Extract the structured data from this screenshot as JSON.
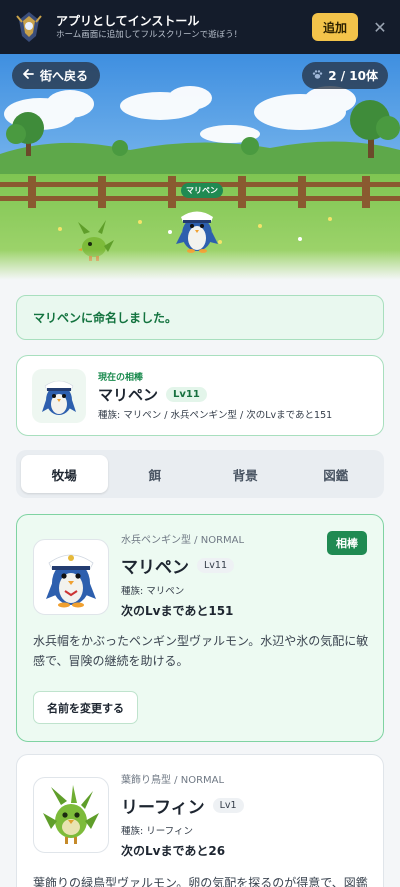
{
  "install_banner": {
    "title": "アプリとしてインストール",
    "subtitle": "ホーム画面に追加してフルスクリーンで遊ぼう！",
    "add_label": "追加",
    "close_glyph": "✕"
  },
  "hero": {
    "back_label": "街へ戻る",
    "count_label": "2 / 10体",
    "name_tag": "マリペン"
  },
  "notice": {
    "text": "マリペンに命名しました。"
  },
  "partner": {
    "label": "現在の相棒",
    "name": "マリペン",
    "level": "Lv11",
    "meta": "種族: マリペン / 水兵ペンギン型 / 次のLvまであと151"
  },
  "tabs": [
    {
      "label": "牧場",
      "active": true
    },
    {
      "label": "餌",
      "active": false
    },
    {
      "label": "背景",
      "active": false
    },
    {
      "label": "図鑑",
      "active": false
    }
  ],
  "monsters": [
    {
      "type_line": "水兵ペンギン型 / NORMAL",
      "name": "マリペン",
      "level": "Lv11",
      "species": "種族: マリペン",
      "next": "次のLvまであと151",
      "desc": "水兵帽をかぶったペンギン型ヴァルモン。水辺や氷の気配に敏感で、冒険の継続を助ける。",
      "rename_label": "名前を変更する",
      "partner_badge": "相棒"
    },
    {
      "type_line": "葉飾り鳥型 / NORMAL",
      "name": "リーフィン",
      "level": "Lv1",
      "species": "種族: リーフィン",
      "next": "次のLvまであと26",
      "desc": "葉飾りの緑鳥型ヴァルモン。卵の気配を探るのが得意で、図鑑"
    }
  ],
  "colors": {
    "accent_green": "#1f8a52",
    "banner_bg": "#141c2b",
    "add_button": "#f3c34a"
  }
}
